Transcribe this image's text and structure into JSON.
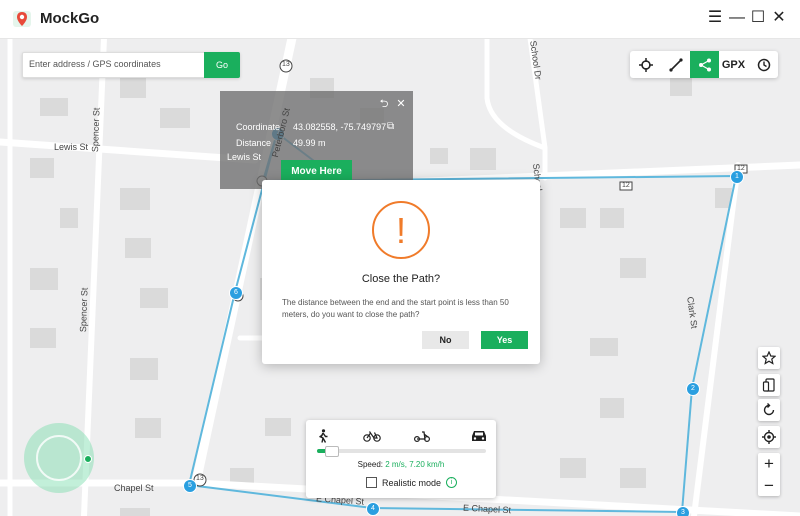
{
  "app": {
    "title": "MockGo"
  },
  "window": {
    "menu": "☰",
    "minimize": "—",
    "maximize": "☐",
    "close": "✕"
  },
  "search": {
    "placeholder": "Enter address / GPS coordinates",
    "go_label": "Go"
  },
  "toolbar": {
    "gpx_label": "GPX"
  },
  "map": {
    "road_labels": [
      "Lewis St",
      "Lewis St",
      "Spencer St",
      "Spencer St",
      "Chapel St",
      "E Chapel St",
      "E Chapel St",
      "Clark St",
      "School Dr",
      "School",
      "Peterboro St",
      "13",
      "12",
      "12",
      "13",
      "13"
    ],
    "waypoints": [
      "1",
      "2",
      "3",
      "4",
      "5",
      "6",
      "7"
    ]
  },
  "popup": {
    "coordinate_label": "Coordinate",
    "coordinate_value": "43.082558, -75.749797",
    "distance_label": "Distance",
    "distance_value": "49.99 m",
    "move_label": "Move Here"
  },
  "dialog": {
    "icon": "!",
    "title": "Close the Path?",
    "message": "The distance between the end and the start point is less than 50 meters, do you want to close the path?",
    "no_label": "No",
    "yes_label": "Yes"
  },
  "speed_panel": {
    "speed_label": "Speed: ",
    "speed_value": "2 m/s, 7.20 km/h",
    "realistic_label": "Realistic mode",
    "speed_fraction": 0.05
  },
  "colors": {
    "accent": "#1aaf5d",
    "route": "#5fb8dd",
    "warning": "#f07b2a",
    "map_bg": "#eeeeef"
  }
}
